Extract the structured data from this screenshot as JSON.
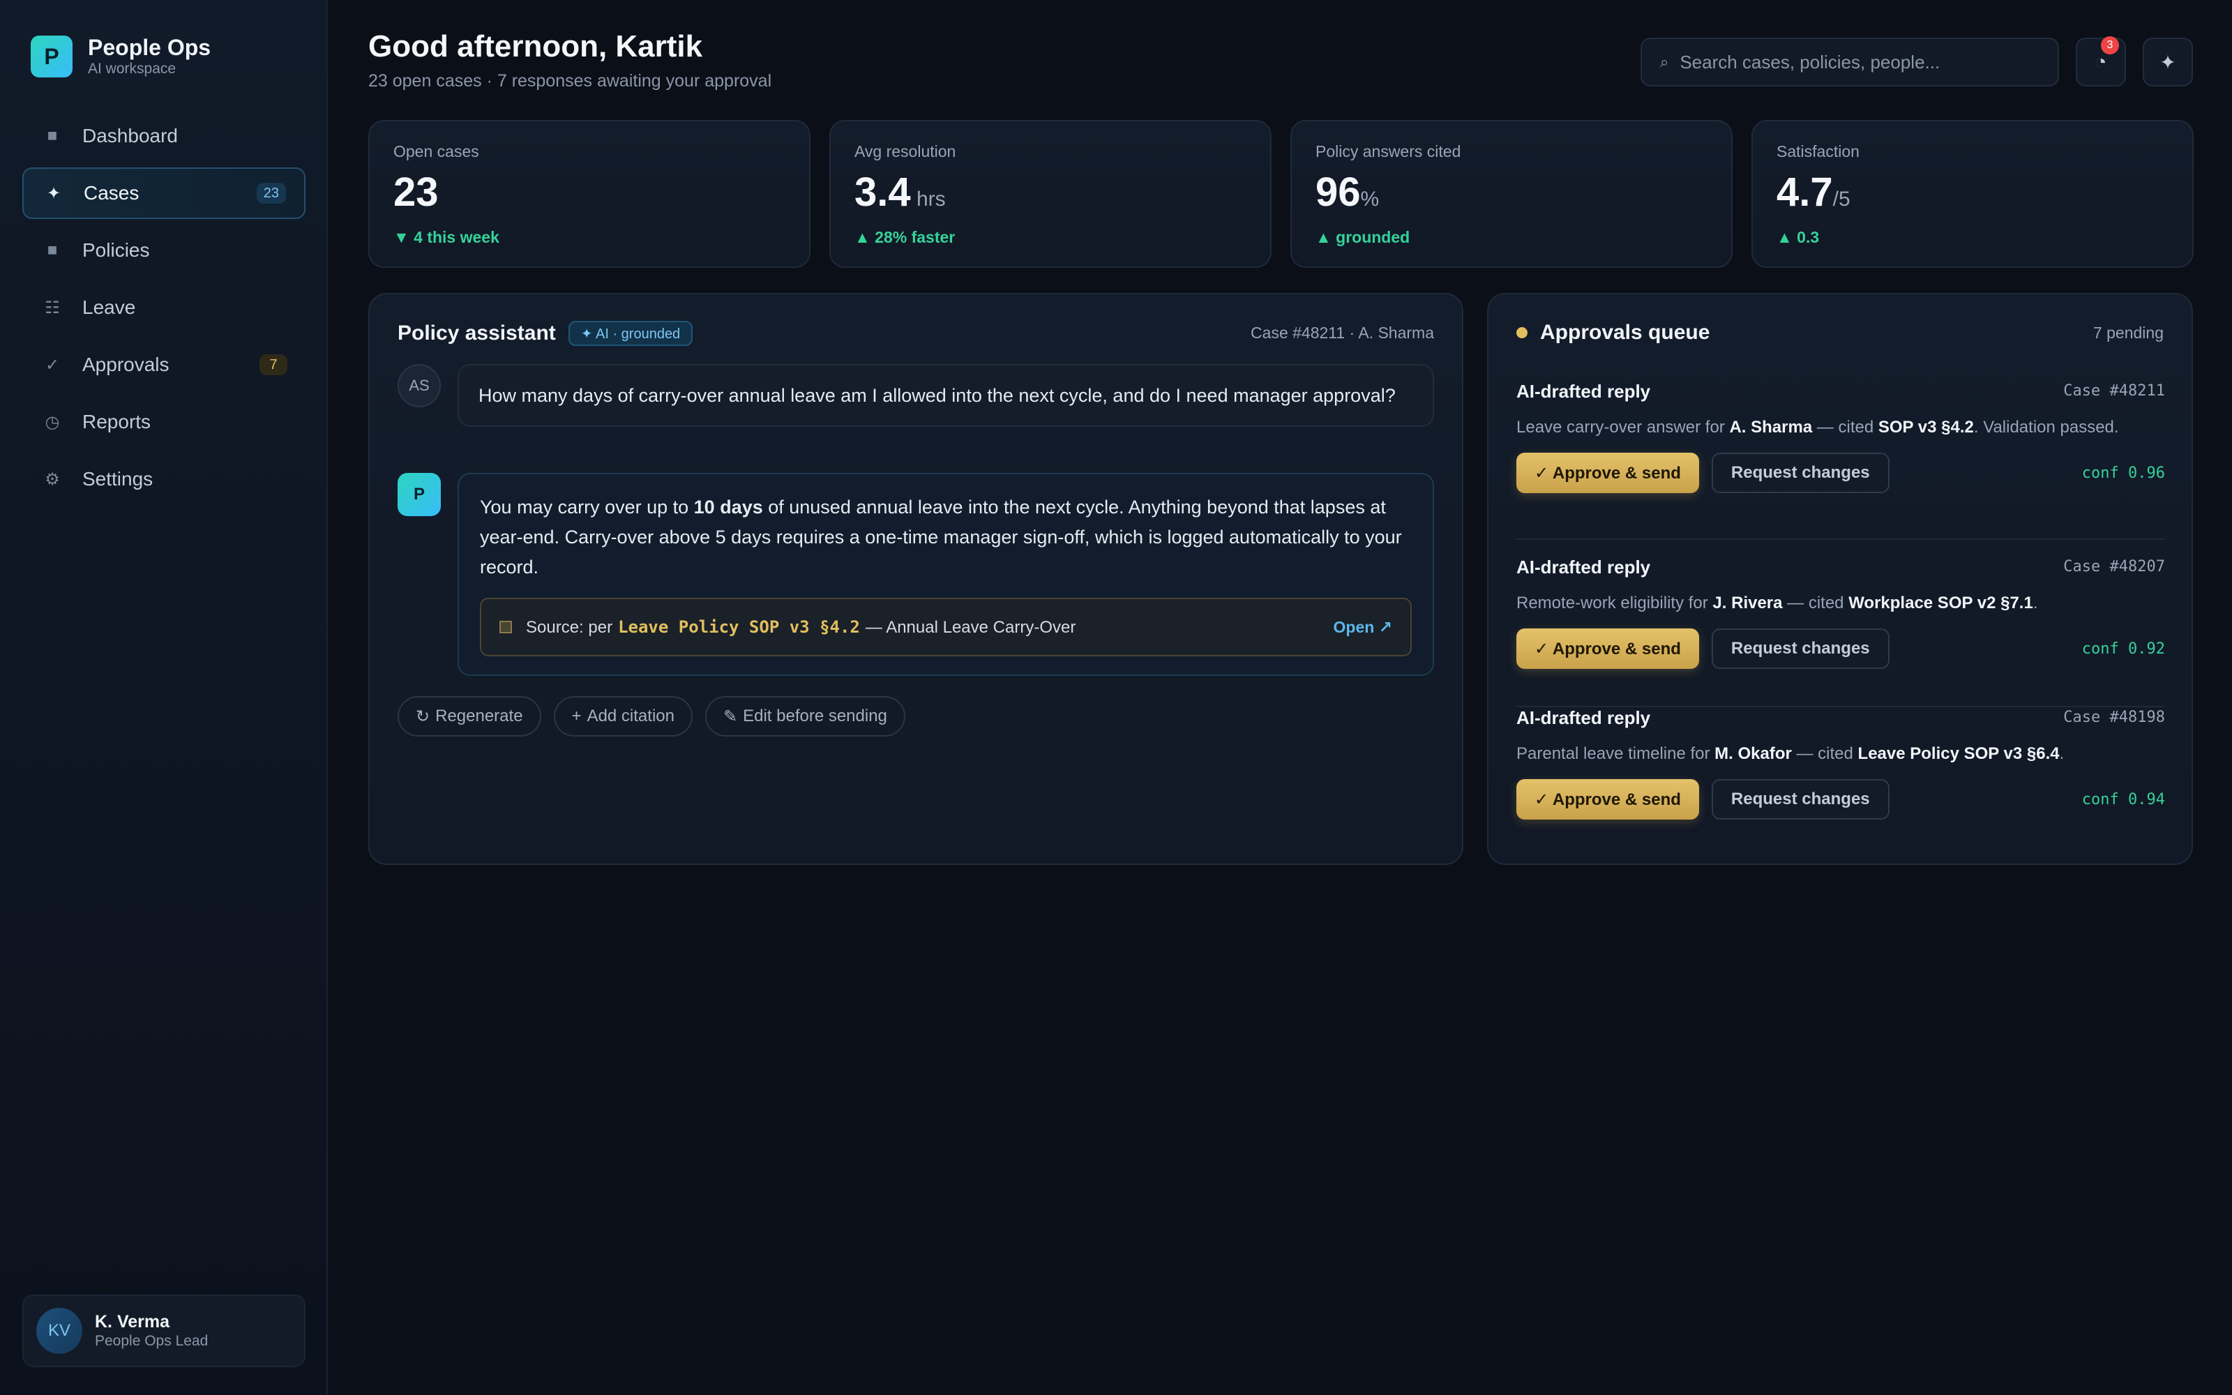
{
  "brand": {
    "logo_letter": "P",
    "name": "People Ops",
    "subtitle": "AI workspace"
  },
  "sidebar": {
    "items": [
      {
        "icon": "square-icon",
        "label": "Dashboard",
        "badge": ""
      },
      {
        "icon": "sparkle-icon",
        "label": "Cases",
        "badge": "23",
        "active": true
      },
      {
        "icon": "square-icon",
        "label": "Policies",
        "badge": ""
      },
      {
        "icon": "list-icon",
        "label": "Leave",
        "badge": ""
      },
      {
        "icon": "check-icon",
        "label": "Approvals",
        "badge": "7"
      },
      {
        "icon": "clock-icon",
        "label": "Reports",
        "badge": ""
      },
      {
        "icon": "gear-icon",
        "label": "Settings",
        "badge": ""
      }
    ]
  },
  "user": {
    "initials": "KV",
    "name": "K. Verma",
    "role": "People Ops Lead"
  },
  "header": {
    "greeting": "Good afternoon, Kartik",
    "subtitle": "23 open cases · 7 responses awaiting your approval",
    "search_placeholder": "Search cases, policies, people...",
    "notification_count": "3"
  },
  "stats": [
    {
      "label": "Open cases",
      "value": "23",
      "unit": "",
      "trend": "▼ 4 this week"
    },
    {
      "label": "Avg resolution",
      "value": "3.4",
      "unit": " hrs",
      "trend": "▲ 28% faster"
    },
    {
      "label": "Policy answers cited",
      "value": "96",
      "unit": "%",
      "trend": "▲ grounded"
    },
    {
      "label": "Satisfaction",
      "value": "4.7",
      "unit": "/5",
      "trend": "▲ 0.3"
    }
  ],
  "assistant": {
    "title": "Policy assistant",
    "chip": "✦ AI · grounded",
    "case_ref": "Case #48211 · A. Sharma",
    "user_initials": "AS",
    "user_message": "How many days of carry-over annual leave am I allowed into the next cycle, and do I need manager approval?",
    "ai_initial": "P",
    "ai_before": "You may carry over up to ",
    "ai_bold": "10 days",
    "ai_after": " of unused annual leave into the next cycle. Anything beyond that lapses at year-end. Carry-over above 5 days requires a one-time manager sign-off, which is logged automatically to your record.",
    "source_prefix": "Source: per",
    "source_policy": "Leave Policy SOP v3 §4.2",
    "source_suffix": "— Annual Leave Carry-Over",
    "source_open": "Open ↗",
    "actions": [
      {
        "icon": "↻",
        "label": "Regenerate"
      },
      {
        "icon": "+",
        "label": "Add citation"
      },
      {
        "icon": "✎",
        "label": "Edit before sending"
      }
    ]
  },
  "queue": {
    "title": "Approvals queue",
    "pending": "7 pending",
    "approve_label": "✓ Approve & send",
    "request_label": "Request changes",
    "items": [
      {
        "title": "AI-drafted reply",
        "case": "Case #48211",
        "d1": "Leave carry-over answer for ",
        "person": "A. Sharma",
        "d2": " — cited ",
        "policy": "SOP v3 §4.2",
        "d3": ". Validation passed.",
        "conf": "conf 0.96"
      },
      {
        "title": "AI-drafted reply",
        "case": "Case #48207",
        "d1": "Remote-work eligibility for ",
        "person": "J. Rivera",
        "d2": " — cited ",
        "policy": "Workplace SOP v2 §7.1",
        "d3": ".",
        "conf": "conf 0.92"
      },
      {
        "title": "AI-drafted reply",
        "case": "Case #48198",
        "d1": "Parental leave timeline for ",
        "person": "M. Okafor",
        "d2": " — cited ",
        "policy": "Leave Policy SOP v3 §6.4",
        "d3": ".",
        "conf": "conf 0.94"
      }
    ]
  },
  "colors": {
    "accent": "#38bdf8",
    "approve": "#e1bf5e",
    "positive": "#34d399",
    "background": "#0b0f17"
  }
}
